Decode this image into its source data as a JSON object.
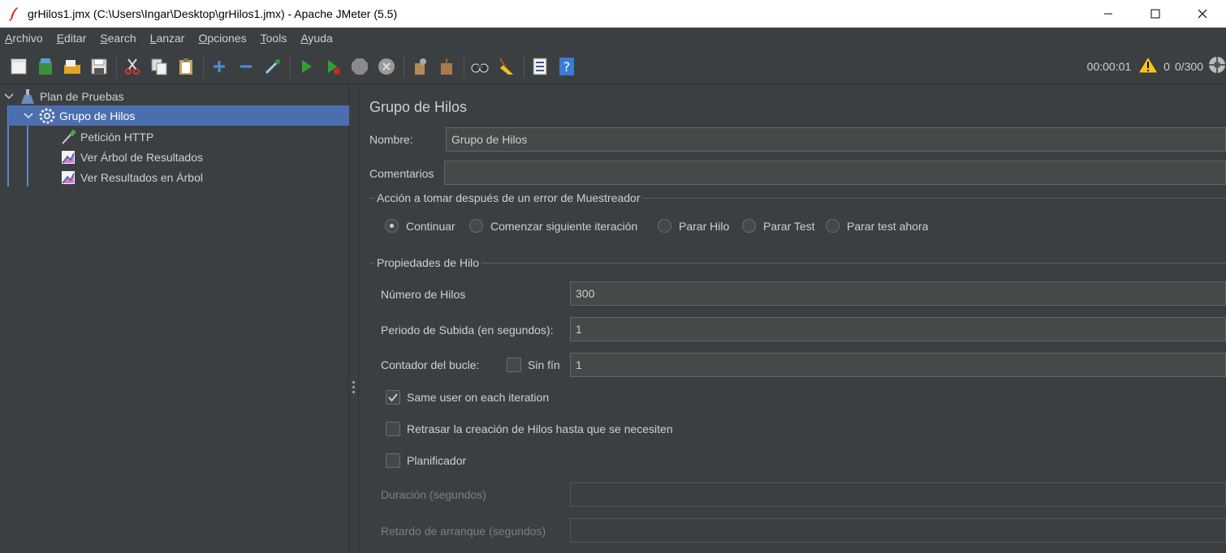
{
  "window": {
    "title": "grHilos1.jmx (C:\\Users\\Ingar\\Desktop\\grHilos1.jmx) - Apache JMeter (5.5)"
  },
  "menu": [
    "Archivo",
    "Editar",
    "Search",
    "Lanzar",
    "Opciones",
    "Tools",
    "Ayuda"
  ],
  "toolbar": {
    "timer": "00:00:01",
    "warnings": "0",
    "threads": "0/300"
  },
  "tree": {
    "items": [
      {
        "label": "Plan de Pruebas",
        "icon": "test-plan-flask-icon"
      },
      {
        "label": "Grupo de Hilos",
        "icon": "thread-group-gear-icon"
      },
      {
        "label": "Petición HTTP",
        "icon": "http-sampler-pipette-icon"
      },
      {
        "label": "Ver Árbol de Resultados",
        "icon": "results-tree-listener-icon"
      },
      {
        "label": "Ver Resultados en Árbol",
        "icon": "results-tree-listener-icon"
      }
    ]
  },
  "panel": {
    "title": "Grupo de Hilos",
    "name_label": "Nombre:",
    "name_value": "Grupo de Hilos",
    "comments_label": "Comentarios",
    "comments_value": "",
    "error_action": {
      "title": "Acción a tomar después de un error de Muestreador",
      "options": [
        "Continuar",
        "Comenzar siguiente iteración",
        "Parar Hilo",
        "Parar Test",
        "Parar test ahora"
      ],
      "selected": "Continuar"
    },
    "thread_props": {
      "title": "Propiedades de Hilo",
      "threads_label": "Número de Hilos",
      "threads_value": "300",
      "rampup_label": "Periodo de Subida (en segundos):",
      "rampup_value": "1",
      "loop_label": "Contador del bucle:",
      "infinite_label": "Sin fín",
      "loop_value": "1",
      "same_user_label": "Same user on each iteration",
      "delay_label": "Retrasar la creación de Hilos hasta que se necesiten",
      "scheduler_label": "Planificador",
      "duration_label": "Duración (segundos)",
      "startup_delay_label": "Retardo de arranque (segundos)"
    }
  }
}
